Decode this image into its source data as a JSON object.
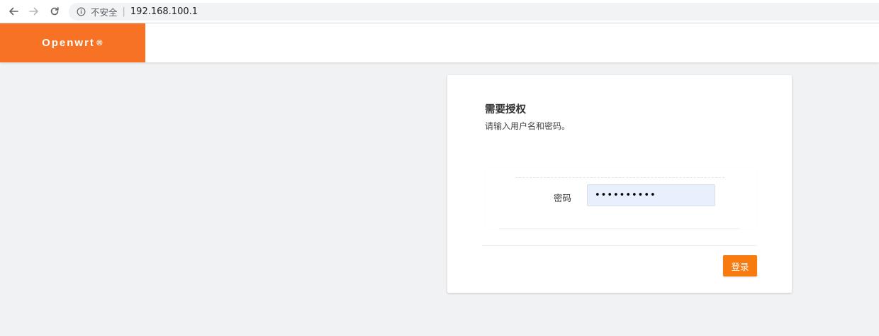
{
  "browser": {
    "back_icon": "back-arrow-icon",
    "forward_icon": "forward-arrow-icon",
    "reload_icon": "reload-icon",
    "security_icon": "info-icon",
    "security_text": "不安全",
    "separator": "|",
    "url": "192.168.100.1"
  },
  "header": {
    "brand": "Openwrt",
    "brand_mark": "®",
    "brand_color": "#f87226"
  },
  "login": {
    "title": "需要授权",
    "description": "请输入用户名和密码。",
    "password_label": "密码",
    "password_value": "••••••••••",
    "submit_label": "登录",
    "accent_color": "#f87b0f"
  }
}
